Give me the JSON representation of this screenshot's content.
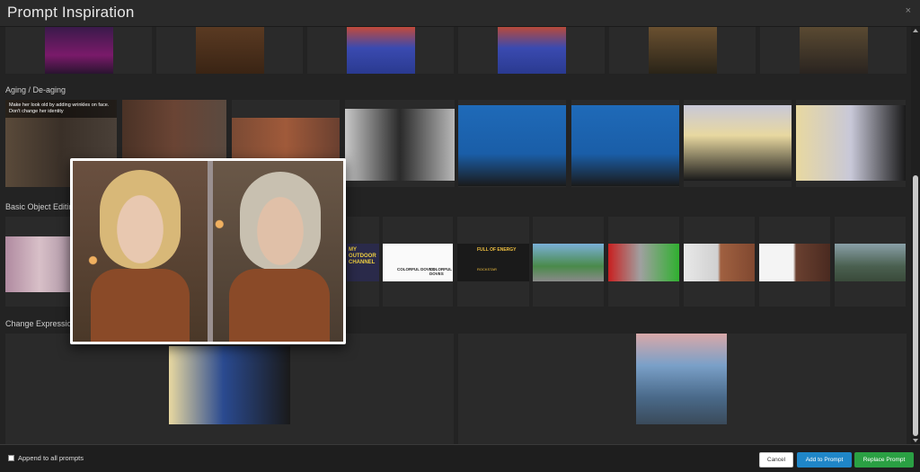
{
  "window": {
    "title": "Prompt Inspiration",
    "close_label": "×"
  },
  "sections": {
    "aging": "Aging / De-aging",
    "object_editing": "Basic Object Editing",
    "expression": "Change Expression"
  },
  "tile_captions": {
    "aging_first": "Make her look old by adding wrinkles on face. Don't change her identity"
  },
  "thumbnail_text": {
    "mychannel": "MY OUTDOOR CHANNEL",
    "doves": [
      "COLORFUL DOVES",
      "COLORFUL DOVES"
    ],
    "energy": [
      "FULL OF ENERGY",
      "ROCKSTAR"
    ]
  },
  "footer": {
    "append_label": "Append to all prompts",
    "cancel_label": "Cancel",
    "add_label": "Add to Prompt",
    "replace_label": "Replace Prompt"
  },
  "colors": {
    "add_button": "#1f86c8",
    "replace_button": "#2aa043",
    "background": "#232323"
  }
}
